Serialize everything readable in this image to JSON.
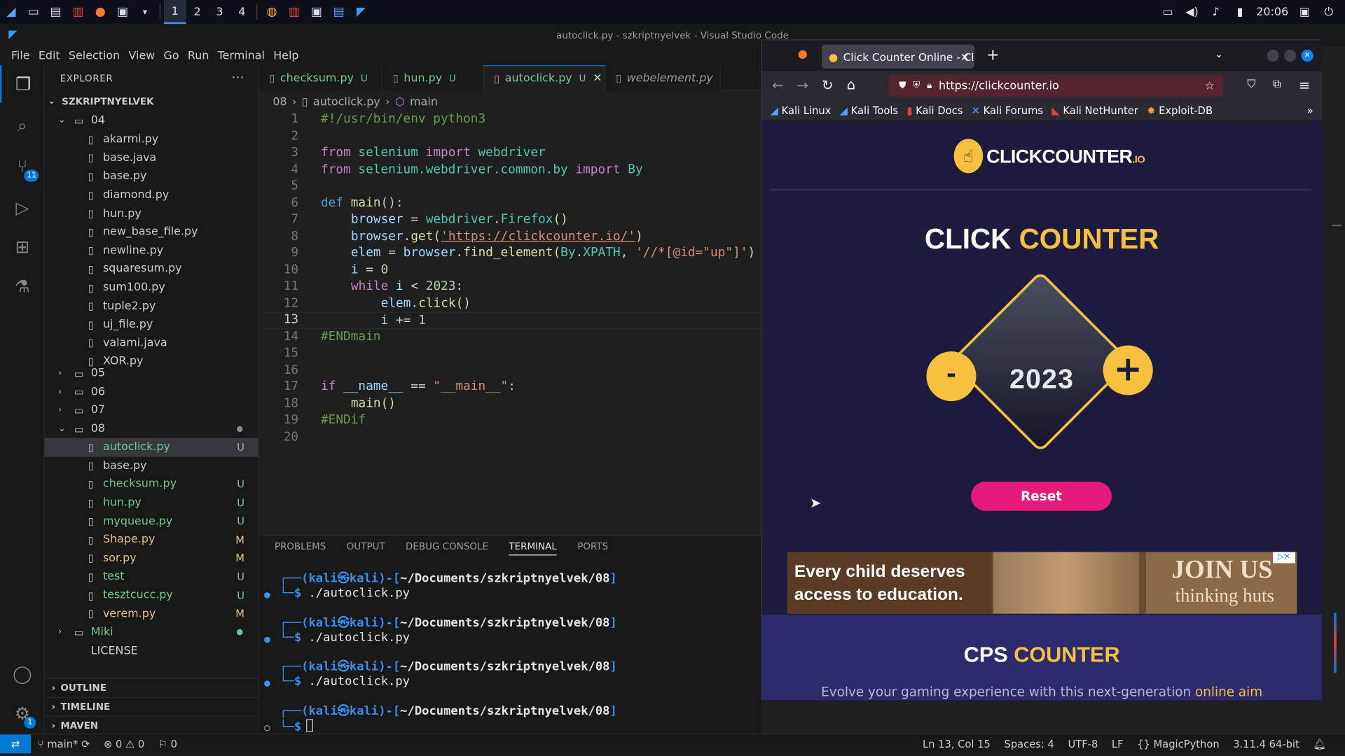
{
  "panel": {
    "workspaces": [
      "1",
      "2",
      "3",
      "4"
    ],
    "clock": "20:06"
  },
  "window": {
    "title": "autoclick.py - szkriptnyelvek - Visual Studio Code"
  },
  "menu": [
    "File",
    "Edit",
    "Selection",
    "View",
    "Go",
    "Run",
    "Terminal",
    "Help"
  ],
  "activity": {
    "scm_badge": "11",
    "settings_badge": "1"
  },
  "explorer": {
    "header": "EXPLORER",
    "root": "SZKRIPTNYELVEK",
    "folder04": "04",
    "files04": [
      "akarmi.py",
      "base.java",
      "base.py",
      "diamond.py",
      "hun.py",
      "new_base_file.py",
      "newline.py",
      "squaresum.py",
      "sum100.py",
      "tuple2.py",
      "uj_file.py",
      "valami.java",
      "XOR.py"
    ],
    "folders": [
      "05",
      "06",
      "07",
      "08"
    ],
    "files08": [
      {
        "name": "autoclick.py",
        "status": "U"
      },
      {
        "name": "base.py",
        "status": ""
      },
      {
        "name": "checksum.py",
        "status": "U"
      },
      {
        "name": "hun.py",
        "status": "U"
      },
      {
        "name": "myqueue.py",
        "status": "U"
      },
      {
        "name": "Shape.py",
        "status": "M"
      },
      {
        "name": "sor.py",
        "status": "M"
      },
      {
        "name": "test",
        "status": "U"
      },
      {
        "name": "tesztcucc.py",
        "status": "U"
      },
      {
        "name": "verem.py",
        "status": "M"
      }
    ],
    "miki": "Miki",
    "license": "LICENSE",
    "sections": [
      "OUTLINE",
      "TIMELINE",
      "MAVEN"
    ]
  },
  "tabs": [
    {
      "label": "checksum.py",
      "status": "U"
    },
    {
      "label": "hun.py",
      "status": "U"
    },
    {
      "label": "autoclick.py",
      "status": "U"
    },
    {
      "label": "webelement.py",
      "status": ""
    }
  ],
  "breadcrumb": {
    "folder": "08",
    "file": "autoclick.py",
    "symbol": "main"
  },
  "code": {
    "l1": "#!/usr/bin/env python3",
    "l3a": "from",
    "l3b": "selenium",
    "l3c": "import",
    "l3d": "webdriver",
    "l4a": "from",
    "l4b": "selenium.webdriver.common.by",
    "l4c": "import",
    "l4d": "By",
    "l6a": "def",
    "l6b": "main",
    "l6c": "():",
    "l7a": "browser",
    "l7b": " = ",
    "l7c": "webdriver",
    "l7d": ".",
    "l7e": "Firefox",
    "l7f": "()",
    "l8a": "browser",
    "l8b": ".",
    "l8c": "get",
    "l8d": "(",
    "l8e": "'https://clickcounter.io/'",
    "l8f": ")",
    "l9a": "elem",
    "l9b": " = ",
    "l9c": "browser",
    "l9d": ".",
    "l9e": "find_element",
    "l9f": "(",
    "l9g": "By",
    "l9h": ".",
    "l9i": "XPATH",
    "l9j": ", ",
    "l9k": "'//*[@id=\"up\"]'",
    "l9l": ")",
    "l10a": "i",
    "l10b": " = ",
    "l10c": "0",
    "l11a": "while",
    "l11b": " i ",
    "l11c": "<",
    "l11d": " 2023",
    "l11e": ":",
    "l12a": "elem",
    "l12b": ".",
    "l12c": "click",
    "l12d": "()",
    "l13a": "i",
    "l13b": " += ",
    "l13c": "1",
    "l14": "#ENDmain",
    "l17a": "if",
    "l17b": " __name__ ",
    "l17c": "==",
    "l17d": " \"__main__\"",
    "l17e": ":",
    "l18a": "main",
    "l18b": "()",
    "l19": "#ENDif",
    "line_numbers": [
      "1",
      "2",
      "3",
      "4",
      "5",
      "6",
      "7",
      "8",
      "9",
      "10",
      "11",
      "12",
      "13",
      "14",
      "15",
      "16",
      "17",
      "18",
      "19",
      "20"
    ]
  },
  "panel_tabs": [
    "PROBLEMS",
    "OUTPUT",
    "DEBUG CONSOLE",
    "TERMINAL",
    "PORTS"
  ],
  "terminal": {
    "prompt_open": "┌──(",
    "user": "kali㉿kali",
    "prompt_mid": ")-[",
    "path": "~/Documents/szkriptnyelvek/08",
    "prompt_close": "]",
    "dollar": "└─$",
    "command": " ./autoclick.py"
  },
  "statusbar": {
    "branch": "main*",
    "errors": "0",
    "warnings": "0",
    "ports": "0",
    "position": "Ln 13, Col 15",
    "spaces": "Spaces: 4",
    "encoding": "UTF-8",
    "eol": "LF",
    "language": "MagicPython",
    "interpreter": "3.11.4 64-bit"
  },
  "browser": {
    "tab_title": "Click Counter Online - Cli",
    "url": "https://clickcounter.io",
    "bookmarks": [
      "Kali Linux",
      "Kali Tools",
      "Kali Docs",
      "Kali Forums",
      "Kali NetHunter",
      "Exploit-DB"
    ],
    "logo_text": "CLICKCOUNTER",
    "logo_suffix": ".IO",
    "heading_white": "CLICK",
    "heading_yellow": "COUNTER",
    "count": "2023",
    "minus": "-",
    "plus": "+",
    "reset": "Reset",
    "ad_text": "Every child deserves access to education.",
    "ad_join": "JOIN US",
    "ad_brand": "thinking huts",
    "cps_white": "CPS",
    "cps_yellow": "COUNTER",
    "cps_sub": "Evolve your gaming experience with this next-generation",
    "cps_link": "online aim"
  },
  "colors": {
    "accent": "#0078d4",
    "yellow": "#f5c13f",
    "pink": "#e6197d",
    "page_bg": "#1c1a3d"
  }
}
